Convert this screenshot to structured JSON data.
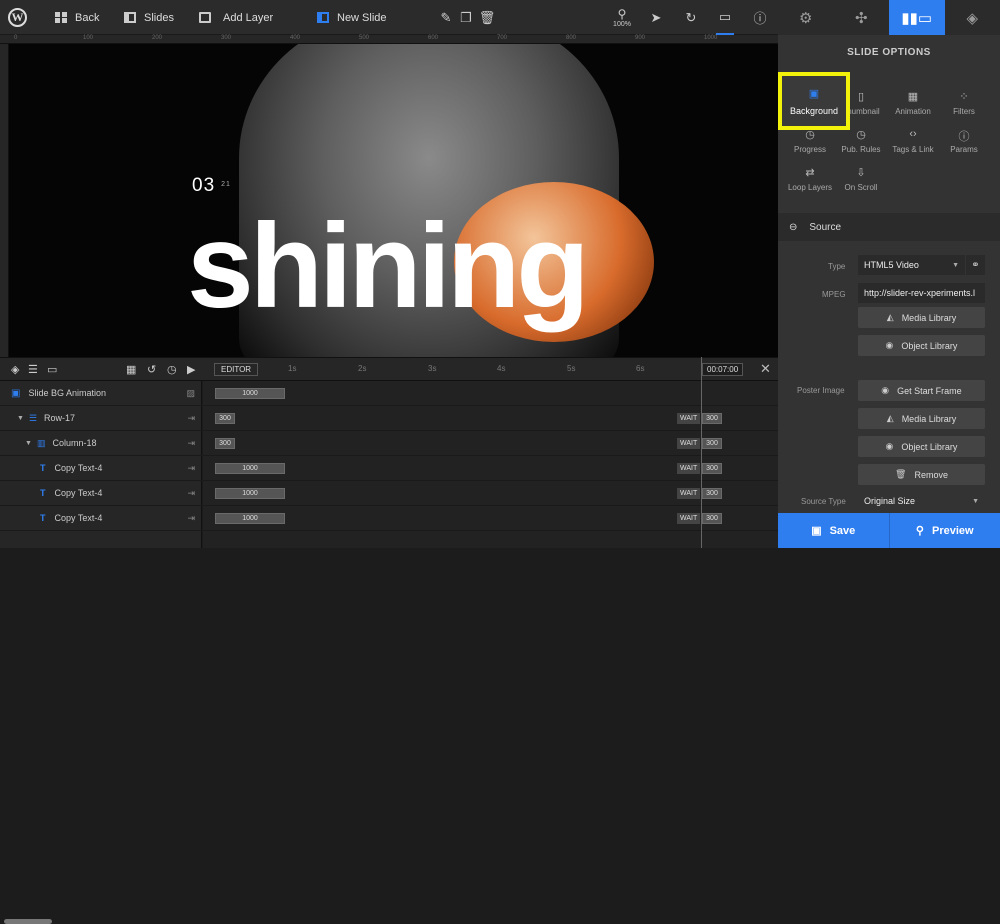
{
  "toolbar": {
    "back_label": "Back",
    "slides_label": "Slides",
    "add_layer_label": "Add Layer",
    "slide_name": "New Slide",
    "zoom": "100%"
  },
  "tabs": [
    "gear-icon",
    "layers-addon-icon",
    "slide-options-icon",
    "layers-icon"
  ],
  "ruler_marks": [
    "0",
    "100",
    "200",
    "300",
    "400",
    "500",
    "600",
    "700",
    "800",
    "900",
    "1000"
  ],
  "canvas": {
    "number": "03",
    "number_small": "21",
    "headline": "shining"
  },
  "timeline": {
    "editor_label": "EDITOR",
    "time_marks": [
      "1s",
      "2s",
      "3s",
      "4s",
      "5s",
      "6s"
    ],
    "total_time": "00:07:00",
    "rows": [
      {
        "label": "Slide BG Animation",
        "bar": "1000",
        "wait": "",
        "end": ""
      },
      {
        "label": "Row-17",
        "bar": "300",
        "wait": "WAIT",
        "end": "300"
      },
      {
        "label": "Column-18",
        "bar": "300",
        "wait": "WAIT",
        "end": "300"
      },
      {
        "label": "Copy Text-4",
        "bar": "1000",
        "wait": "WAIT",
        "end": "300"
      },
      {
        "label": "Copy Text-4",
        "bar": "1000",
        "wait": "WAIT",
        "end": "300"
      },
      {
        "label": "Copy Text-4",
        "bar": "1000",
        "wait": "WAIT",
        "end": "300"
      }
    ]
  },
  "panel": {
    "title": "SLIDE OPTIONS",
    "options": [
      {
        "label": "Background",
        "icon": "image-icon"
      },
      {
        "label": "Thumbnail",
        "icon": "thumbnail-icon"
      },
      {
        "label": "Animation",
        "icon": "film-icon"
      },
      {
        "label": "Filters",
        "icon": "filters-icon"
      },
      {
        "label": "Progress",
        "icon": "clock-icon"
      },
      {
        "label": "Pub. Rules",
        "icon": "clock-icon"
      },
      {
        "label": "Tags & Link",
        "icon": "code-icon"
      },
      {
        "label": "Params",
        "icon": "info-icon"
      },
      {
        "label": "Loop Layers",
        "icon": "loop-icon"
      },
      {
        "label": "On Scroll",
        "icon": "scroll-icon"
      }
    ],
    "source_label": "Source",
    "type_label": "Type",
    "type_value": "HTML5 Video",
    "mpeg_label": "MPEG",
    "mpeg_value": "http://slider-rev-xperiments.l",
    "media_library": "Media Library",
    "object_library": "Object Library",
    "poster_label": "Poster Image",
    "get_start_frame": "Get Start Frame",
    "remove": "Remove",
    "source_type_label": "Source Type",
    "source_type_value": "Original Size"
  },
  "footer": {
    "save": "Save",
    "preview": "Preview"
  },
  "colors": {
    "accent": "#2f7ef0",
    "highlight": "#f2f20a"
  }
}
